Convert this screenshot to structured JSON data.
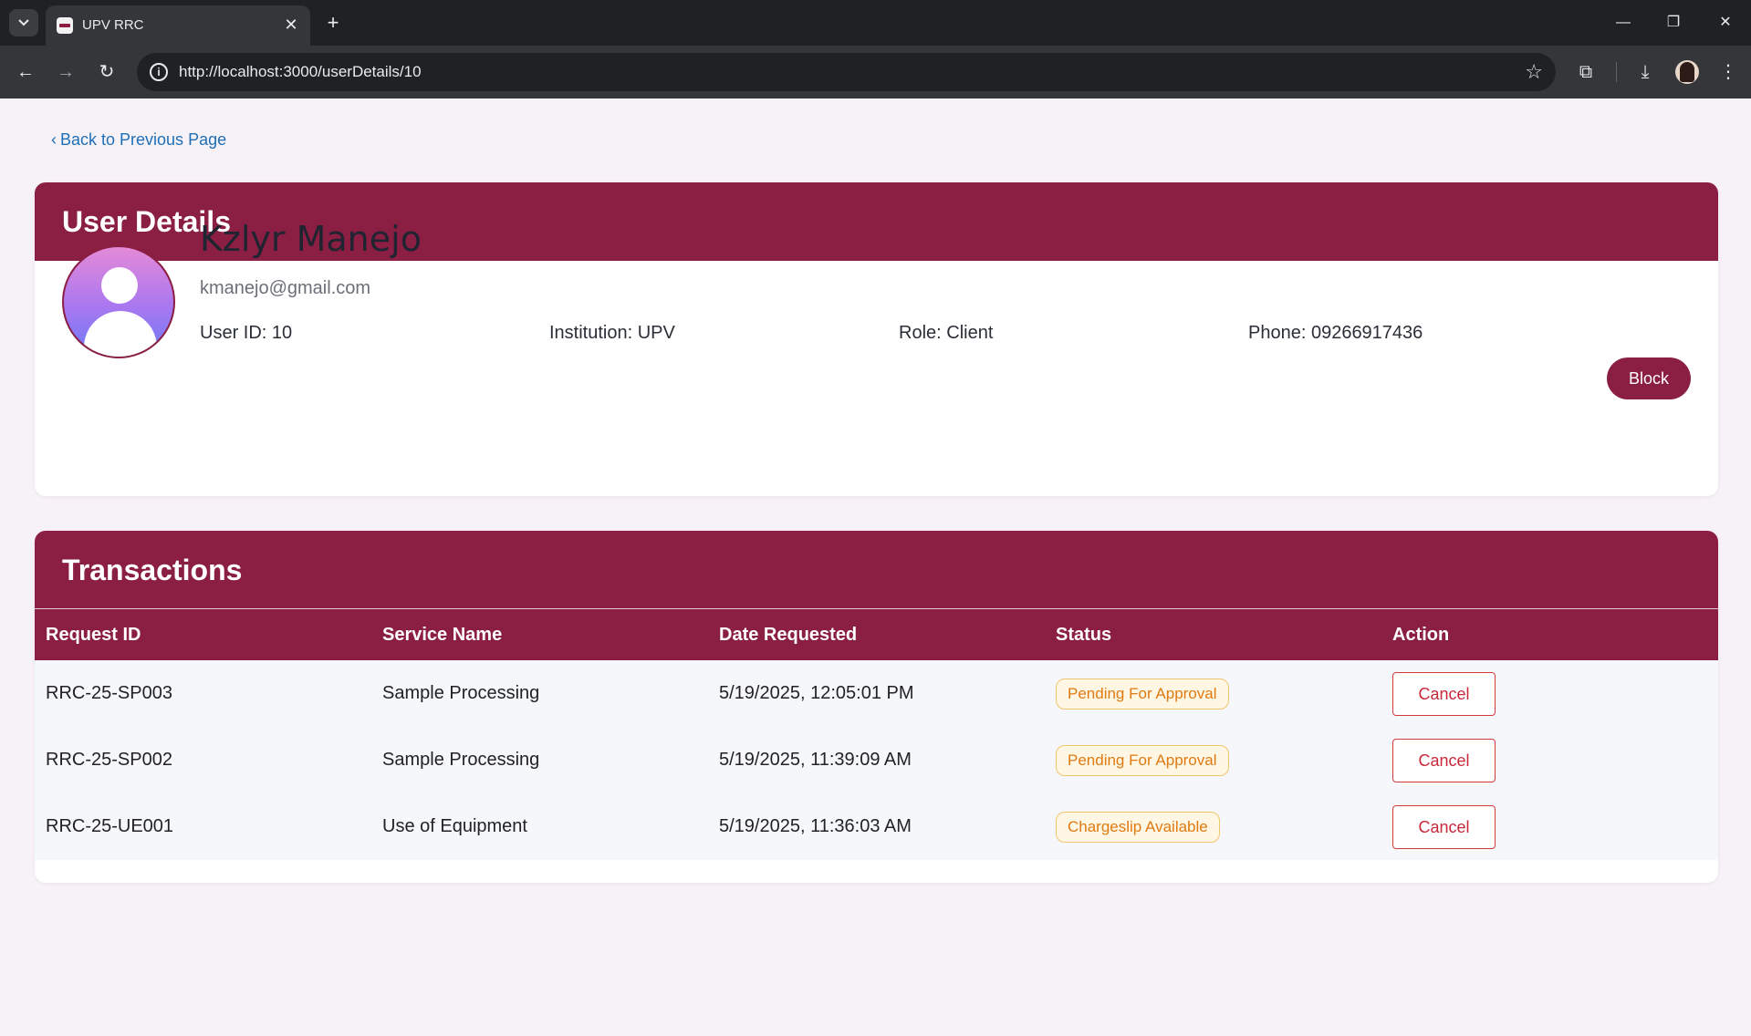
{
  "browser": {
    "tab_title": "UPV RRC",
    "url": "http://localhost:3000/userDetails/10"
  },
  "page": {
    "back_link": "Back to Previous Page"
  },
  "user_details": {
    "title": "User Details",
    "name": "Kzlyr Manejo",
    "email": "kmanejo@gmail.com",
    "user_id": "User ID: 10",
    "institution": "Institution: UPV",
    "role": "Role: Client",
    "phone": "Phone: 09266917436",
    "block_label": "Block"
  },
  "transactions": {
    "title": "Transactions",
    "headers": [
      "Request ID",
      "Service Name",
      "Date Requested",
      "Status",
      "Action"
    ],
    "rows": [
      {
        "request_id": "RRC-25-SP003",
        "service": "Sample Processing",
        "date": "5/19/2025, 12:05:01 PM",
        "status": "Pending For Approval",
        "action": "Cancel"
      },
      {
        "request_id": "RRC-25-SP002",
        "service": "Sample Processing",
        "date": "5/19/2025, 11:39:09 AM",
        "status": "Pending For Approval",
        "action": "Cancel"
      },
      {
        "request_id": "RRC-25-UE001",
        "service": "Use of Equipment",
        "date": "5/19/2025, 11:36:03 AM",
        "status": "Chargeslip Available",
        "action": "Cancel"
      }
    ]
  },
  "colors": {
    "brand": "#8b1e43",
    "link": "#1f6fb8",
    "status_badge": "#e07a12",
    "cancel": "#c8283a"
  }
}
